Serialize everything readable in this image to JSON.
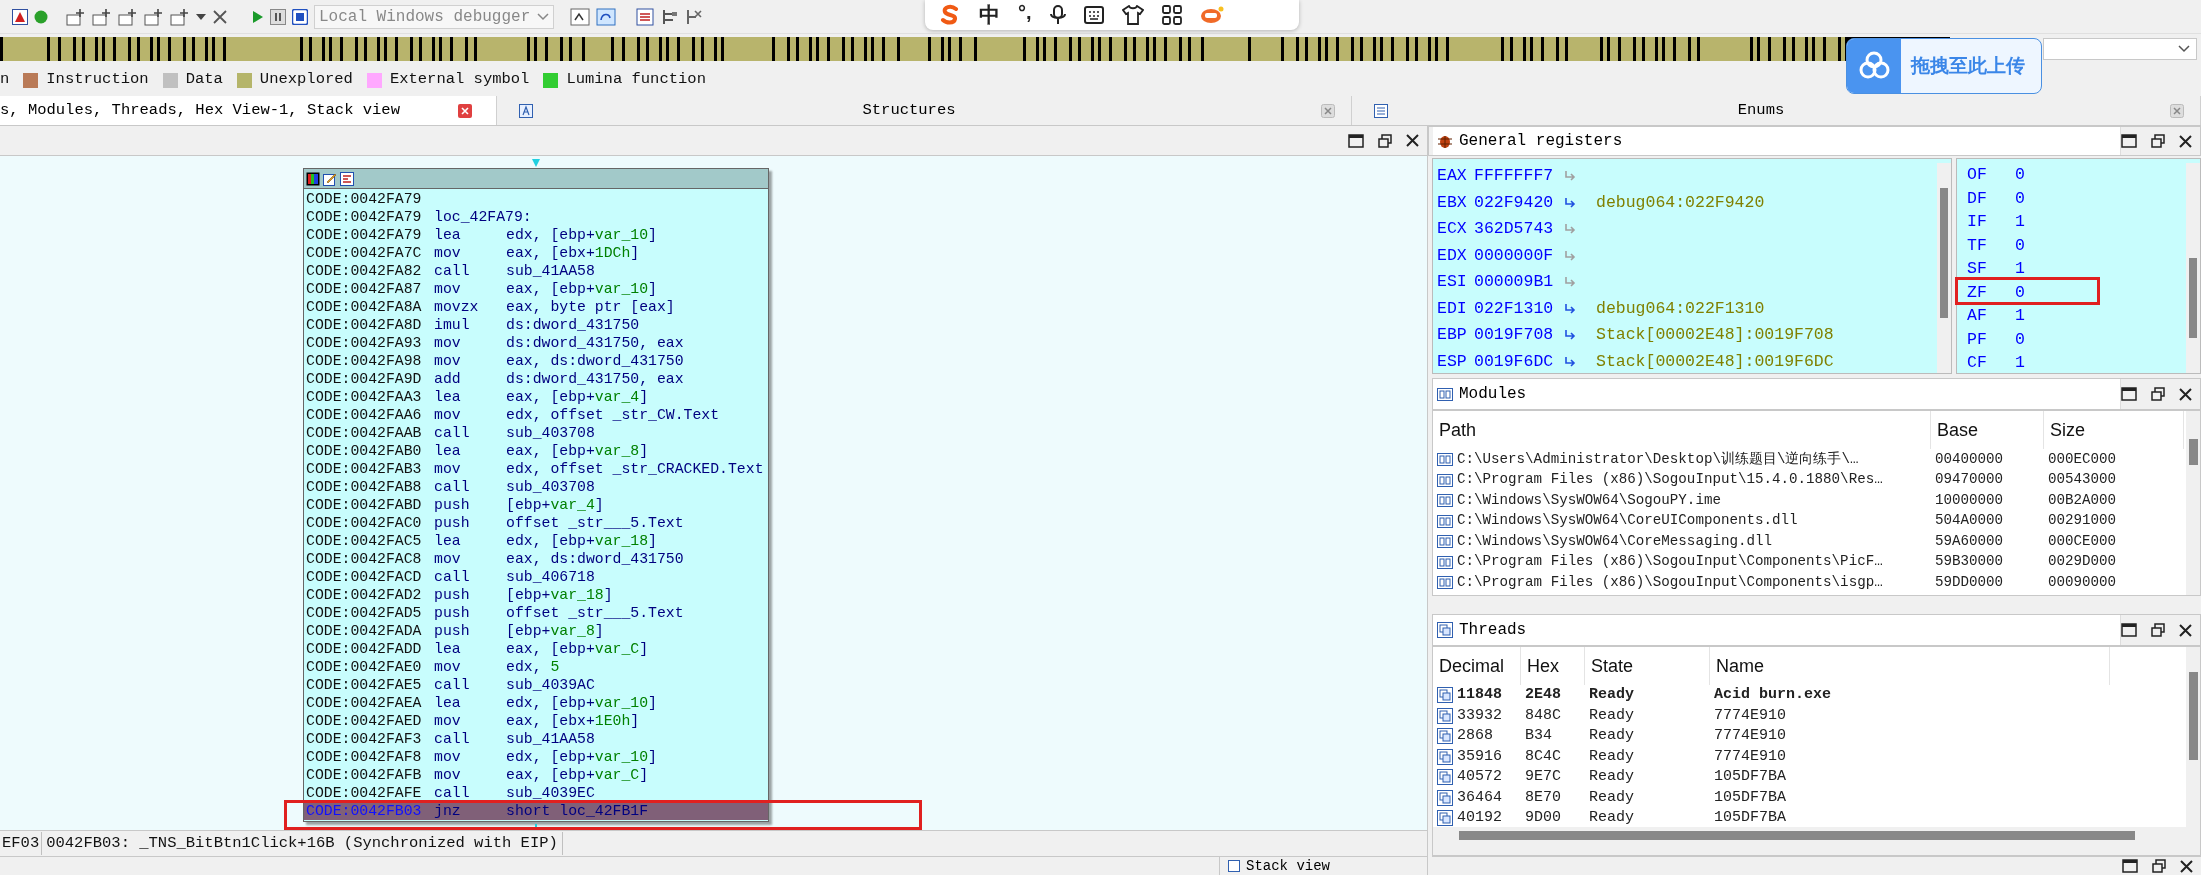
{
  "toolbar": {
    "debugger": "Local Windows debugger"
  },
  "ime_bar": {
    "mode": "中",
    "punctuation": "°,"
  },
  "upload_button": {
    "label": "拖拽至此上传"
  },
  "legend": {
    "cut_label": "n",
    "items": [
      {
        "label": "Instruction",
        "color": "#b97a57"
      },
      {
        "label": "Data",
        "color": "#c0c0c0"
      },
      {
        "label": "Unexplored",
        "color": "#b5b56a"
      },
      {
        "label": "External symbol",
        "color": "#ffa8ff"
      },
      {
        "label": "Lumina function",
        "color": "#32cd32"
      }
    ]
  },
  "tabs": [
    {
      "label": "s, Modules, Threads, Hex View-1, Stack view",
      "selected": true
    },
    {
      "label": "Structures",
      "selected": false
    },
    {
      "label": "Enums",
      "selected": false
    }
  ],
  "graph": {
    "lines": [
      {
        "address": "CODE:0042FA79",
        "selected": false
      },
      {
        "address": "CODE:0042FA79",
        "mnemonic": "loc_42FA79:",
        "selected": false
      },
      {
        "address": "CODE:0042FA79",
        "mnemonic": "lea",
        "operand": [
          "edx, [ebp+",
          "var_10",
          "]"
        ],
        "selected": false
      },
      {
        "address": "CODE:0042FA7C",
        "mnemonic": "mov",
        "operand": [
          "eax, [ebx+",
          "1DCh",
          "]"
        ],
        "selected": false
      },
      {
        "address": "CODE:0042FA82",
        "mnemonic": "call",
        "operand": [
          "sub_41AA58"
        ],
        "selected": false
      },
      {
        "address": "CODE:0042FA87",
        "mnemonic": "mov",
        "operand": [
          "eax, [ebp+",
          "var_10",
          "]"
        ],
        "selected": false
      },
      {
        "address": "CODE:0042FA8A",
        "mnemonic": "movzx",
        "operand": [
          "eax, byte ptr [eax]"
        ],
        "selected": false
      },
      {
        "address": "CODE:0042FA8D",
        "mnemonic": "imul",
        "operand": [
          "ds:dword_431750"
        ],
        "selected": false
      },
      {
        "address": "CODE:0042FA93",
        "mnemonic": "mov",
        "operand": [
          "ds:dword_431750, eax"
        ],
        "selected": false
      },
      {
        "address": "CODE:0042FA98",
        "mnemonic": "mov",
        "operand": [
          "eax, ds:dword_431750"
        ],
        "selected": false
      },
      {
        "address": "CODE:0042FA9D",
        "mnemonic": "add",
        "operand": [
          "ds:dword_431750, eax"
        ],
        "selected": false
      },
      {
        "address": "CODE:0042FAA3",
        "mnemonic": "lea",
        "operand": [
          "eax, [ebp+",
          "var_4",
          "]"
        ],
        "selected": false
      },
      {
        "address": "CODE:0042FAA6",
        "mnemonic": "mov",
        "operand": [
          "edx, offset _str_CW.Text"
        ],
        "selected": false
      },
      {
        "address": "CODE:0042FAAB",
        "mnemonic": "call",
        "operand": [
          "sub_403708"
        ],
        "selected": false
      },
      {
        "address": "CODE:0042FAB0",
        "mnemonic": "lea",
        "operand": [
          "eax, [ebp+",
          "var_8",
          "]"
        ],
        "selected": false
      },
      {
        "address": "CODE:0042FAB3",
        "mnemonic": "mov",
        "operand": [
          "edx, offset _str_CRACKED.Text"
        ],
        "selected": false
      },
      {
        "address": "CODE:0042FAB8",
        "mnemonic": "call",
        "operand": [
          "sub_403708"
        ],
        "selected": false
      },
      {
        "address": "CODE:0042FABD",
        "mnemonic": "push",
        "operand": [
          "[ebp+",
          "var_4",
          "]"
        ],
        "selected": false
      },
      {
        "address": "CODE:0042FAC0",
        "mnemonic": "push",
        "operand": [
          "offset _str___5.Text"
        ],
        "selected": false
      },
      {
        "address": "CODE:0042FAC5",
        "mnemonic": "lea",
        "operand": [
          "edx, [ebp+",
          "var_18",
          "]"
        ],
        "selected": false
      },
      {
        "address": "CODE:0042FAC8",
        "mnemonic": "mov",
        "operand": [
          "eax, ds:dword_431750"
        ],
        "selected": false
      },
      {
        "address": "CODE:0042FACD",
        "mnemonic": "call",
        "operand": [
          "sub_406718"
        ],
        "selected": false
      },
      {
        "address": "CODE:0042FAD2",
        "mnemonic": "push",
        "operand": [
          "[ebp+",
          "var_18",
          "]"
        ],
        "selected": false
      },
      {
        "address": "CODE:0042FAD5",
        "mnemonic": "push",
        "operand": [
          "offset _str___5.Text"
        ],
        "selected": false
      },
      {
        "address": "CODE:0042FADA",
        "mnemonic": "push",
        "operand": [
          "[ebp+",
          "var_8",
          "]"
        ],
        "selected": false
      },
      {
        "address": "CODE:0042FADD",
        "mnemonic": "lea",
        "operand": [
          "eax, [ebp+",
          "var_C",
          "]"
        ],
        "selected": false
      },
      {
        "address": "CODE:0042FAE0",
        "mnemonic": "mov",
        "operand": [
          "edx, ",
          "5"
        ],
        "selected": false
      },
      {
        "address": "CODE:0042FAE5",
        "mnemonic": "call",
        "operand": [
          "sub_4039AC"
        ],
        "selected": false
      },
      {
        "address": "CODE:0042FAEA",
        "mnemonic": "lea",
        "operand": [
          "edx, [ebp+",
          "var_10",
          "]"
        ],
        "selected": false
      },
      {
        "address": "CODE:0042FAED",
        "mnemonic": "mov",
        "operand": [
          "eax, [ebx+",
          "1E0h",
          "]"
        ],
        "selected": false
      },
      {
        "address": "CODE:0042FAF3",
        "mnemonic": "call",
        "operand": [
          "sub_41AA58"
        ],
        "selected": false
      },
      {
        "address": "CODE:0042FAF8",
        "mnemonic": "mov",
        "operand": [
          "edx, [ebp+",
          "var_10",
          "]"
        ],
        "selected": false
      },
      {
        "address": "CODE:0042FAFB",
        "mnemonic": "mov",
        "operand": [
          "eax, [ebp+",
          "var_C",
          "]"
        ],
        "selected": false
      },
      {
        "address": "CODE:0042FAFE",
        "mnemonic": "call",
        "operand": [
          "sub_4039EC"
        ],
        "selected": false
      },
      {
        "address": "CODE:0042FB03",
        "mnemonic": "jnz",
        "operand": [
          "short loc_42FB1F"
        ],
        "selected": true
      }
    ]
  },
  "status_line": {
    "cell_1": "EF03",
    "cell_2": "0042FB03: _TNS_BitBtn1Click+16B (Synchronized with EIP)"
  },
  "registers": {
    "title": "General registers",
    "rows": [
      {
        "name": "EAX",
        "value": "FFFFFFF7"
      },
      {
        "name": "EBX",
        "value": "022F9420",
        "target": "debug064:022F9420"
      },
      {
        "name": "ECX",
        "value": "362D5743"
      },
      {
        "name": "EDX",
        "value": "0000000F"
      },
      {
        "name": "ESI",
        "value": "000009B1"
      },
      {
        "name": "EDI",
        "value": "022F1310",
        "target": "debug064:022F1310"
      },
      {
        "name": "EBP",
        "value": "0019F708",
        "target": "Stack[00002E48]:0019F708"
      },
      {
        "name": "ESP",
        "value": "0019F6DC",
        "target": "Stack[00002E48]:0019F6DC"
      }
    ],
    "flags": [
      {
        "name": "OF",
        "value": "0"
      },
      {
        "name": "DF",
        "value": "0"
      },
      {
        "name": "IF",
        "value": "1"
      },
      {
        "name": "TF",
        "value": "0"
      },
      {
        "name": "SF",
        "value": "1"
      },
      {
        "name": "ZF",
        "value": "0"
      },
      {
        "name": "AF",
        "value": "1"
      },
      {
        "name": "PF",
        "value": "0"
      },
      {
        "name": "CF",
        "value": "1"
      }
    ]
  },
  "modules": {
    "title": "Modules",
    "columns": [
      "Path",
      "Base",
      "Size"
    ],
    "rows": [
      [
        "C:\\Users\\Administrator\\Desktop\\训练题目\\逆向练手\\…",
        "00400000",
        "000EC000"
      ],
      [
        "C:\\Program Files (x86)\\SogouInput\\15.4.0.1880\\Res…",
        "09470000",
        "00543000"
      ],
      [
        "C:\\Windows\\SysWOW64\\SogouPY.ime",
        "10000000",
        "00B2A000"
      ],
      [
        "C:\\Windows\\SysWOW64\\CoreUIComponents.dll",
        "504A0000",
        "00291000"
      ],
      [
        "C:\\Windows\\SysWOW64\\CoreMessaging.dll",
        "59A60000",
        "000CE000"
      ],
      [
        "C:\\Program Files (x86)\\SogouInput\\Components\\PicF…",
        "59B30000",
        "0029D000"
      ],
      [
        "C:\\Program Files (x86)\\SogouInput\\Components\\isgp…",
        "59DD0000",
        "00090000"
      ]
    ]
  },
  "threads": {
    "title": "Threads",
    "columns": [
      "Decimal",
      "Hex",
      "State",
      "Name"
    ],
    "rows": [
      {
        "cells": [
          "11848",
          "2E48",
          "Ready",
          "Acid burn.exe"
        ],
        "current": true
      },
      {
        "cells": [
          "33932",
          "848C",
          "Ready",
          "7774E910"
        ],
        "current": false
      },
      {
        "cells": [
          "2868",
          "B34",
          "Ready",
          "7774E910"
        ],
        "current": false
      },
      {
        "cells": [
          "35916",
          "8C4C",
          "Ready",
          "7774E910"
        ],
        "current": false
      },
      {
        "cells": [
          "40572",
          "9E7C",
          "Ready",
          "105DF7BA"
        ],
        "current": false
      },
      {
        "cells": [
          "36464",
          "8E70",
          "Ready",
          "105DF7BA"
        ],
        "current": false
      },
      {
        "cells": [
          "40192",
          "9D00",
          "Ready",
          "105DF7BA"
        ],
        "current": false
      }
    ]
  },
  "bottom_panel": {
    "title": "Stack view"
  }
}
